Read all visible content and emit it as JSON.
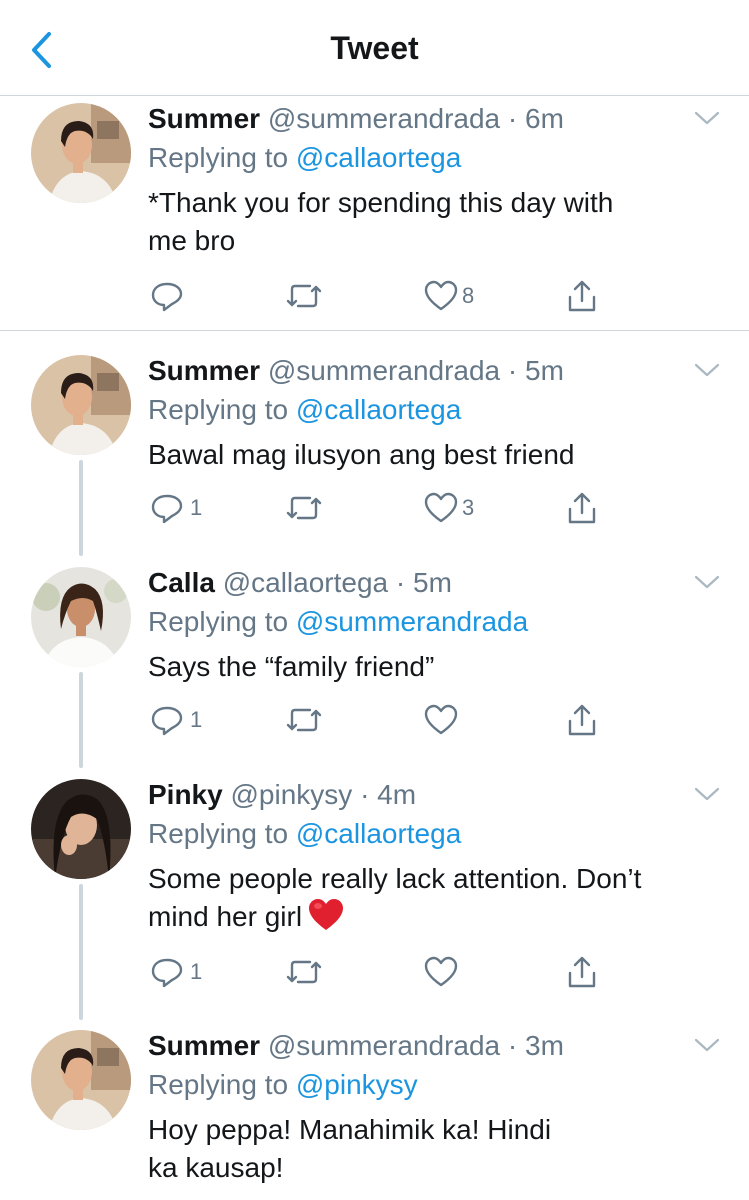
{
  "header": {
    "title": "Tweet"
  },
  "tweets": [
    {
      "name": "Summer",
      "handle": "@summerandrada",
      "dot": "·",
      "time": "6m",
      "replying_prefix": "Replying to ",
      "replying_to": "@callaortega",
      "text_line1": "*Thank you for spending this day with",
      "text_line2": "me bro",
      "replies": "",
      "likes": "8"
    },
    {
      "name": "Summer",
      "handle": "@summerandrada",
      "dot": "·",
      "time": "5m",
      "replying_prefix": "Replying to ",
      "replying_to": "@callaortega",
      "text_line1": "Bawal mag ilusyon ang best friend",
      "text_line2": "",
      "replies": "1",
      "likes": "3"
    },
    {
      "name": "Calla",
      "handle": "@callaortega",
      "dot": "·",
      "time": "5m",
      "replying_prefix": "Replying to ",
      "replying_to": "@summerandrada",
      "text_line1": "Says the “family friend”",
      "text_line2": "",
      "replies": "1",
      "likes": ""
    },
    {
      "name": "Pinky",
      "handle": "@pinkysy",
      "dot": "·",
      "time": "4m",
      "replying_prefix": "Replying to ",
      "replying_to": "@callaortega",
      "text_line1": "Some people really lack attention. Don’t",
      "text_line2": "mind her girl",
      "replies": "1",
      "likes": ""
    },
    {
      "name": "Summer",
      "handle": "@summerandrada",
      "dot": "·",
      "time": "3m",
      "replying_prefix": "Replying to ",
      "replying_to": "@pinkysy",
      "text_line1": "Hoy peppa! Manahimik ka! Hindi",
      "text_line2": "ka kausap!",
      "replies": "",
      "likes": ""
    }
  ],
  "icons": {
    "back": "chevron-left-icon",
    "more": "chevron-down-icon",
    "reply": "reply-icon",
    "retweet": "retweet-icon",
    "like": "heart-icon",
    "share": "share-icon",
    "emoji": "red-heart-emoji"
  },
  "colors": {
    "accent": "#1b95e0",
    "text": "#14171a",
    "secondary": "#657786",
    "divider": "#cfd6dc",
    "thread": "#ccd6dd",
    "emoji_heart": "#e0202f"
  }
}
